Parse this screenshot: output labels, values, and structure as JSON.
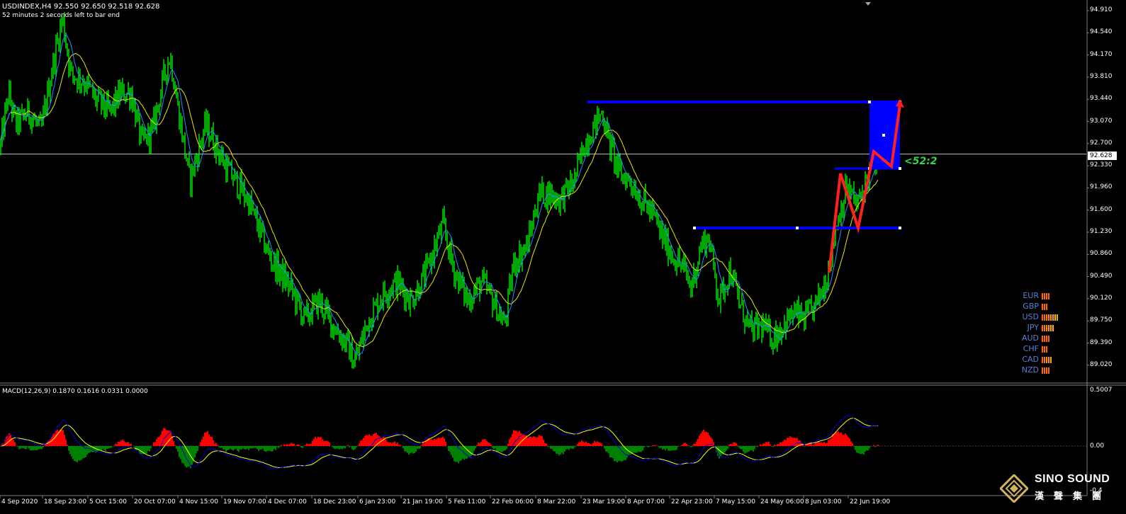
{
  "header": {
    "symbol_line": "USDINDEX,H4  92.550 92.650 92.518 92.628",
    "timer_line": "52 minutes 2 seconds left to bar end"
  },
  "price_axis": {
    "labels": [
      "94.910",
      "94.540",
      "94.170",
      "93.810",
      "93.440",
      "93.070",
      "92.700",
      "92.330",
      "91.960",
      "91.600",
      "91.230",
      "90.860",
      "90.490",
      "90.120",
      "89.750",
      "89.390",
      "89.020"
    ],
    "current_price": "92.628"
  },
  "time_axis": {
    "labels": [
      "4 Sep 2020",
      "18 Sep 23:00",
      "5 Oct 15:00",
      "20 Oct 07:00",
      "4 Nov 15:00",
      "19 Nov 07:00",
      "4 Dec 07:00",
      "18 Dec 23:00",
      "6 Jan 23:00",
      "21 Jan 19:00",
      "5 Feb 11:00",
      "22 Feb 06:00",
      "8 Mar 22:00",
      "23 Mar 19:00",
      "8 Apr 07:00",
      "22 Apr 23:00",
      "7 May 15:00",
      "24 May 06:00",
      "8 Jun 03:00",
      "22 Jun 19:00"
    ]
  },
  "macd": {
    "label": "MACD(12,26,9) 0.1870 0.1616 0.0331 0.0000",
    "top_value": "0.5007",
    "zero_value": "0.00",
    "bottom_value": "-0.4"
  },
  "timer_overlay": "<52:2",
  "currency_strength": [
    {
      "name": "EUR",
      "bars": [
        "#ff6a00",
        "#ff6a00",
        "#ff6a00",
        "#ff6a00"
      ]
    },
    {
      "name": "GBP",
      "bars": [
        "#ff6a00",
        "#ff6a00",
        "#ff6a00"
      ]
    },
    {
      "name": "USD",
      "bars": [
        "#ff5a00",
        "#ff6a00",
        "#ff7a00",
        "#ff8a00",
        "#ff9a00",
        "#ffaa00",
        "#ffba00",
        "#c8c800"
      ]
    },
    {
      "name": "JPY",
      "bars": [
        "#ff6a00",
        "#ff7a00",
        "#ff8a00",
        "#ff9a00",
        "#ffaa00",
        "#ffba00"
      ]
    },
    {
      "name": "AUD",
      "bars": [
        "#ff6a00",
        "#ff6a00",
        "#ff6a00",
        "#ff6a00"
      ]
    },
    {
      "name": "CHF",
      "bars": [
        "#ff6a00",
        "#ff6a00",
        "#ff6a00"
      ]
    },
    {
      "name": "CAD",
      "bars": [
        "#ff6a00",
        "#ff7a00",
        "#ff8a00",
        "#ff9a00",
        "#ffaa00"
      ]
    },
    {
      "name": "NZD",
      "bars": [
        "#ff6a00",
        "#ff6a00",
        "#ff6a00",
        "#ff6a00"
      ]
    }
  ],
  "logo": {
    "title": "SINO SOUND",
    "subtitle": "漢聲集團"
  },
  "colors": {
    "candle": "#00ff00",
    "ma_fast": "#1e90ff",
    "ma_slow": "#e8e800",
    "level_line": "#0000ff",
    "arrow": "#ff2020",
    "macd_pos": "#ff0000",
    "macd_neg": "#008000",
    "macd_signal": "#ffff00",
    "macd_line": "#0000cc"
  },
  "chart_data": {
    "type": "candlestick",
    "instrument": "USDINDEX",
    "timeframe": "H4",
    "ylim": [
      89.02,
      94.91
    ],
    "last": {
      "open": 92.55,
      "high": 92.65,
      "low": 92.518,
      "close": 92.628
    },
    "close_profile": [
      [
        0,
        92.7
      ],
      [
        12,
        93.6
      ],
      [
        22,
        93.1
      ],
      [
        40,
        93.3
      ],
      [
        58,
        93.0
      ],
      [
        72,
        93.9
      ],
      [
        88,
        94.8
      ],
      [
        100,
        93.9
      ],
      [
        118,
        93.8
      ],
      [
        135,
        93.5
      ],
      [
        155,
        93.3
      ],
      [
        170,
        93.6
      ],
      [
        185,
        93.6
      ],
      [
        200,
        92.8
      ],
      [
        215,
        93.0
      ],
      [
        232,
        93.9
      ],
      [
        240,
        94.2
      ],
      [
        252,
        93.3
      ],
      [
        268,
        92.2
      ],
      [
        290,
        93.1
      ],
      [
        320,
        92.4
      ],
      [
        350,
        91.9
      ],
      [
        380,
        91.0
      ],
      [
        410,
        90.5
      ],
      [
        430,
        90.0
      ],
      [
        450,
        90.3
      ],
      [
        470,
        89.9
      ],
      [
        490,
        89.6
      ],
      [
        500,
        89.3
      ],
      [
        520,
        90.0
      ],
      [
        540,
        90.4
      ],
      [
        560,
        90.6
      ],
      [
        580,
        90.3
      ],
      [
        600,
        90.7
      ],
      [
        615,
        91.2
      ],
      [
        625,
        91.5
      ],
      [
        640,
        90.8
      ],
      [
        660,
        90.3
      ],
      [
        680,
        90.6
      ],
      [
        700,
        90.2
      ],
      [
        712,
        89.9
      ],
      [
        725,
        90.9
      ],
      [
        745,
        91.2
      ],
      [
        760,
        92.0
      ],
      [
        775,
        92.0
      ],
      [
        790,
        91.9
      ],
      [
        810,
        92.2
      ],
      [
        825,
        92.8
      ],
      [
        840,
        93.1
      ],
      [
        850,
        93.3
      ],
      [
        860,
        92.8
      ],
      [
        875,
        92.3
      ],
      [
        890,
        92.2
      ],
      [
        905,
        91.9
      ],
      [
        920,
        91.7
      ],
      [
        935,
        91.3
      ],
      [
        950,
        91.0
      ],
      [
        965,
        90.8
      ],
      [
        975,
        90.5
      ],
      [
        990,
        91.2
      ],
      [
        1000,
        91.3
      ],
      [
        1015,
        90.3
      ],
      [
        1030,
        90.8
      ],
      [
        1045,
        90.2
      ],
      [
        1060,
        89.8
      ],
      [
        1075,
        89.9
      ],
      [
        1090,
        89.7
      ],
      [
        1105,
        89.9
      ],
      [
        1120,
        90.1
      ],
      [
        1135,
        90.0
      ],
      [
        1150,
        90.2
      ],
      [
        1165,
        90.6
      ],
      [
        1180,
        91.5
      ],
      [
        1195,
        92.1
      ],
      [
        1210,
        91.8
      ],
      [
        1225,
        92.3
      ],
      [
        1240,
        92.6
      ]
    ],
    "levels": [
      93.5,
      92.45,
      91.6
    ],
    "zone": {
      "from": 92.45,
      "to": 93.5
    }
  }
}
